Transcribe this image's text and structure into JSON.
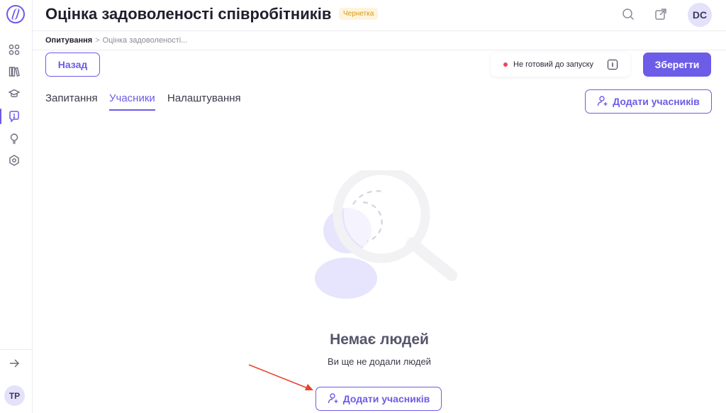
{
  "app": {
    "title": "Оцінка задоволеності співробітників",
    "status_badge": "Чернетка",
    "user_initials": "DC"
  },
  "sidebar": {
    "user_initials": "TP",
    "items": [
      {
        "icon": "grid-icon"
      },
      {
        "icon": "books-icon"
      },
      {
        "icon": "graduation-cap-icon"
      },
      {
        "icon": "survey-icon",
        "active": true
      },
      {
        "icon": "lightbulb-icon"
      },
      {
        "icon": "settings-hex-icon"
      }
    ],
    "collapse_icon": "arrow-right-icon"
  },
  "breadcrumb": {
    "root": "Опитування",
    "separator": ">",
    "current": "Оцінка задоволеності..."
  },
  "toolbar": {
    "back_label": "Назад",
    "status_text": "Не готовий до запуску",
    "info_symbol": "i",
    "save_label": "Зберегти"
  },
  "tabs": [
    {
      "label": "Запитання",
      "active": false
    },
    {
      "label": "Учасники",
      "active": true
    },
    {
      "label": "Налаштування",
      "active": false
    }
  ],
  "add_participants_label": "Додати учасників",
  "empty_state": {
    "title": "Немає людей",
    "subtitle": "Ви ще не додали людей",
    "button_label": "Додати учасників"
  },
  "colors": {
    "accent": "#6c5ce7",
    "status_dot": "#f0455a",
    "badge_bg": "#fff4db",
    "badge_text": "#d39a1f",
    "annotation_arrow": "#e8412c"
  }
}
